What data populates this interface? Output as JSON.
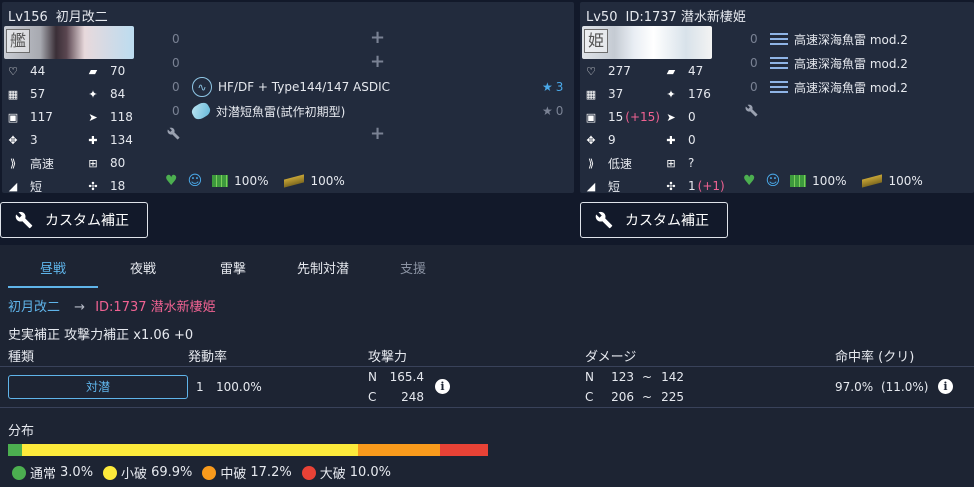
{
  "left": {
    "level": "Lv156",
    "name": "初月改二",
    "portrait_tag": "艦",
    "stats": [
      {
        "icon": "hp-icon",
        "value": "44"
      },
      {
        "icon": "armor-icon",
        "value": "70"
      },
      {
        "icon": "evasion-icon",
        "value": "57"
      },
      {
        "icon": "aa-icon",
        "value": "84"
      },
      {
        "icon": "firepower-icon",
        "value": "117"
      },
      {
        "icon": "torpedo-icon",
        "value": "118"
      },
      {
        "icon": "accuracy-icon",
        "value": "3"
      },
      {
        "icon": "asw-icon",
        "value": "134"
      },
      {
        "icon": "speed-icon",
        "value": "高速"
      },
      {
        "icon": "los-icon",
        "value": "80"
      },
      {
        "icon": "range-icon",
        "value": "短"
      },
      {
        "icon": "luck-icon",
        "value": "18"
      }
    ],
    "slots": [
      {
        "count": "0",
        "name": "",
        "stars": "",
        "empty": true
      },
      {
        "count": "0",
        "name": "",
        "stars": "",
        "empty": true
      },
      {
        "count": "0",
        "name": "HF/DF + Type144/147 ASDIC",
        "stars": "3",
        "empty": false,
        "icon": "sonar-icon"
      },
      {
        "count": "0",
        "name": "対潜短魚雷(試作初期型)",
        "stars": "0",
        "empty": false,
        "icon": "depth-charge-icon"
      }
    ],
    "condition": {
      "fuel": "100%",
      "ammo": "100%"
    }
  },
  "right": {
    "level": "Lv50",
    "name": "ID:1737 潜水新棲姫",
    "portrait_tag": "姫",
    "stats": [
      {
        "icon": "hp-icon",
        "value": "277"
      },
      {
        "icon": "armor-icon",
        "value": "47"
      },
      {
        "icon": "evasion-icon",
        "value": "37"
      },
      {
        "icon": "aa-icon",
        "value": "176"
      },
      {
        "icon": "firepower-icon",
        "value": "15",
        "bonus": "(+15)"
      },
      {
        "icon": "torpedo-icon",
        "value": "0"
      },
      {
        "icon": "accuracy-icon",
        "value": "9"
      },
      {
        "icon": "asw-icon",
        "value": "0"
      },
      {
        "icon": "speed-icon",
        "value": "低速"
      },
      {
        "icon": "los-icon",
        "value": "?"
      },
      {
        "icon": "range-icon",
        "value": "短"
      },
      {
        "icon": "luck-icon",
        "value": "1",
        "bonus": "(+1)"
      }
    ],
    "slots": [
      {
        "count": "0",
        "name": "高速深海魚雷 mod.2"
      },
      {
        "count": "0",
        "name": "高速深海魚雷 mod.2"
      },
      {
        "count": "0",
        "name": "高速深海魚雷 mod.2"
      }
    ],
    "condition": {
      "fuel": "100%",
      "ammo": "100%"
    }
  },
  "custom_button_label": "カスタム補正",
  "tabs": [
    {
      "label": "昼戦",
      "active": true
    },
    {
      "label": "夜戦"
    },
    {
      "label": "雷撃"
    },
    {
      "label": "先制対潜"
    },
    {
      "label": "支援",
      "disabled": true
    }
  ],
  "matchup": {
    "attacker": "初月改二",
    "arrow": "→",
    "defender": "ID:1737 潜水新棲姫"
  },
  "correction": "史実補正 攻撃力補正 x1.06 +0",
  "table": {
    "headers": {
      "type": "種類",
      "rate": "発動率",
      "power": "攻撃力",
      "damage": "ダメージ",
      "hit": "命中率 (クリ)"
    },
    "row": {
      "type": "対潜",
      "count": "1",
      "rate": "100.0%",
      "power_n_label": "N",
      "power_n": "165.4",
      "power_c_label": "C",
      "power_c": "248",
      "dmg_n_label": "N",
      "dmg_n_min": "123",
      "dmg_n_max": "142",
      "dmg_c_label": "C",
      "dmg_c_min": "206",
      "dmg_c_max": "225",
      "tilde": "~",
      "hit": "97.0%",
      "crit": "(11.0%)"
    }
  },
  "distribution": {
    "title": "分布",
    "segments": [
      {
        "label": "通常",
        "value": "3.0%",
        "pct": 3.0,
        "color": "#4caf50"
      },
      {
        "label": "小破",
        "value": "69.9%",
        "pct": 69.9,
        "color": "#fdea3b"
      },
      {
        "label": "中破",
        "value": "17.2%",
        "pct": 17.2,
        "color": "#f89a1c"
      },
      {
        "label": "大破",
        "value": "10.0%",
        "pct": 10.0,
        "color": "#e84236"
      }
    ]
  }
}
